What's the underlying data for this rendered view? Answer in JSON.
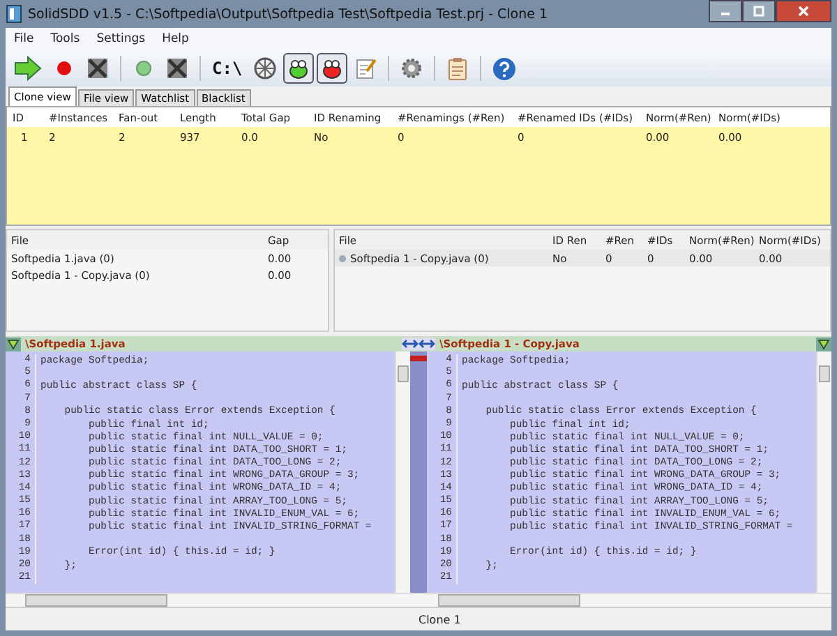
{
  "window": {
    "title": "SolidSDD v1.5 - C:\\Softpedia\\Output\\Softpedia Test\\Softpedia Test.prj - Clone 1"
  },
  "menu": [
    "File",
    "Tools",
    "Settings",
    "Help"
  ],
  "toolbar": [
    {
      "kind": "run",
      "pressed": false
    },
    {
      "kind": "red-dot",
      "pressed": false
    },
    {
      "kind": "cross",
      "pressed": false
    },
    {
      "kind": "sep"
    },
    {
      "kind": "green-dot",
      "pressed": false
    },
    {
      "kind": "cross",
      "pressed": false
    },
    {
      "kind": "sep"
    },
    {
      "kind": "text",
      "label": "C:\\",
      "pressed": false
    },
    {
      "kind": "wheel",
      "pressed": false
    },
    {
      "kind": "bug-green",
      "pressed": true
    },
    {
      "kind": "bug-red",
      "pressed": true
    },
    {
      "kind": "notepad",
      "pressed": false
    },
    {
      "kind": "sep"
    },
    {
      "kind": "gear",
      "pressed": false
    },
    {
      "kind": "sep"
    },
    {
      "kind": "clipboard",
      "pressed": false
    },
    {
      "kind": "sep"
    },
    {
      "kind": "help",
      "pressed": false
    }
  ],
  "tabs": [
    {
      "label": "Clone view",
      "selected": true
    },
    {
      "label": "File view",
      "selected": false
    },
    {
      "label": "Watchlist",
      "selected": false
    },
    {
      "label": "Blacklist",
      "selected": false
    }
  ],
  "clones": {
    "columns": [
      "ID",
      "#Instances",
      "Fan-out",
      "Length",
      "Total Gap",
      "ID Renaming",
      "#Renamings (#Ren)",
      "#Renamed IDs (#IDs)",
      "Norm(#Ren)",
      "Norm(#IDs)"
    ],
    "rows": [
      {
        "selected": true,
        "cells": [
          "1",
          "2",
          "2",
          "937",
          "0.0",
          "No",
          "0",
          "0",
          "0.00",
          "0.00"
        ]
      }
    ]
  },
  "instances": {
    "columns": [
      "File",
      "Gap"
    ],
    "rows": [
      {
        "cells": [
          "Softpedia 1.java (0)",
          "0.00"
        ]
      },
      {
        "cells": [
          "Softpedia 1 - Copy.java (0)",
          "0.00"
        ]
      }
    ]
  },
  "renaming": {
    "columns": [
      "File",
      "ID Ren",
      "#Ren",
      "#IDs",
      "Norm(#Ren)",
      "Norm(#IDs)"
    ],
    "rows": [
      {
        "cells": [
          "Softpedia 1 - Copy.java (0)",
          "No",
          "0",
          "0",
          "0.00",
          "0.00"
        ]
      }
    ]
  },
  "editors": [
    {
      "title": "\\Softpedia 1.java",
      "lines": [
        {
          "n": "4",
          "code": "package Softpedia;"
        },
        {
          "n": "5"
        },
        {
          "n": "6",
          "code": "public abstract class SP {"
        },
        {
          "n": "7"
        },
        {
          "n": "8",
          "code": "    public static class Error extends Exception {"
        },
        {
          "n": "9",
          "code": "        public final int id;"
        },
        {
          "n": "10",
          "code": "        public static final int NULL_VALUE = 0;"
        },
        {
          "n": "11",
          "code": "        public static final int DATA_TOO_SHORT = 1;"
        },
        {
          "n": "12",
          "code": "        public static final int DATA_TOO_LONG = 2;"
        },
        {
          "n": "13",
          "code": "        public static final int WRONG_DATA_GROUP = 3;"
        },
        {
          "n": "14",
          "code": "        public static final int WRONG_DATA_ID = 4;"
        },
        {
          "n": "15",
          "code": "        public static final int ARRAY_TOO_LONG = 5;"
        },
        {
          "n": "16",
          "code": "        public static final int INVALID_ENUM_VAL = 6;"
        },
        {
          "n": "17",
          "code": "        public static final int INVALID_STRING_FORMAT ="
        },
        {
          "n": "18"
        },
        {
          "n": "19",
          "code": "        Error(int id) { this.id = id; }"
        },
        {
          "n": "20",
          "code": "    };"
        },
        {
          "n": "21"
        }
      ]
    },
    {
      "title": "\\Softpedia 1 - Copy.java",
      "lines": [
        {
          "n": "4",
          "code": "package Softpedia;"
        },
        {
          "n": "5"
        },
        {
          "n": "6",
          "code": "public abstract class SP {"
        },
        {
          "n": "7"
        },
        {
          "n": "8",
          "code": "    public static class Error extends Exception {"
        },
        {
          "n": "9",
          "code": "        public final int id;"
        },
        {
          "n": "10",
          "code": "        public static final int NULL_VALUE = 0;"
        },
        {
          "n": "11",
          "code": "        public static final int DATA_TOO_SHORT = 1;"
        },
        {
          "n": "12",
          "code": "        public static final int DATA_TOO_LONG = 2;"
        },
        {
          "n": "13",
          "code": "        public static final int WRONG_DATA_GROUP = 3;"
        },
        {
          "n": "14",
          "code": "        public static final int WRONG_DATA_ID = 4;"
        },
        {
          "n": "15",
          "code": "        public static final int ARRAY_TOO_LONG = 5;"
        },
        {
          "n": "16",
          "code": "        public static final int INVALID_ENUM_VAL = 6;"
        },
        {
          "n": "17",
          "code": "        public static final int INVALID_STRING_FORMAT ="
        },
        {
          "n": "18"
        },
        {
          "n": "19",
          "code": "        Error(int id) { this.id = id; }"
        },
        {
          "n": "20",
          "code": "    };"
        },
        {
          "n": "21"
        }
      ]
    }
  ],
  "status_bar": {
    "text": "Clone 1"
  }
}
